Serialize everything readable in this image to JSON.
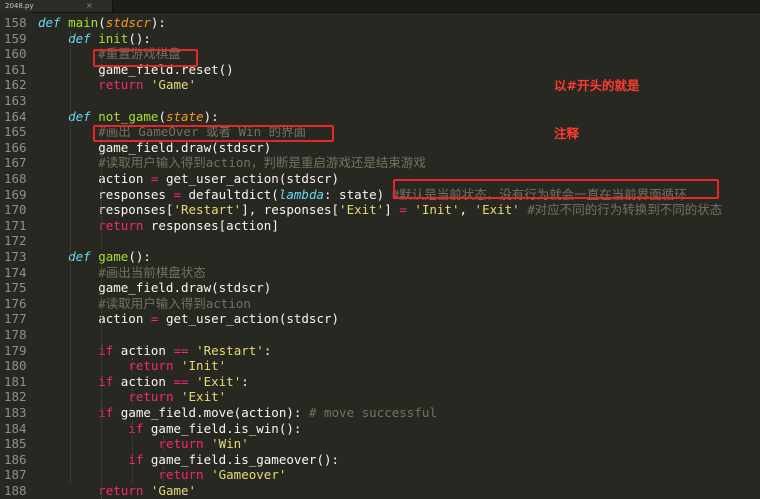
{
  "tab": {
    "filename": "2048.py",
    "close": "×"
  },
  "annotation": {
    "line1": "以#开头的就是",
    "line2": "注释"
  },
  "lines": [
    {
      "n": "158",
      "tokens": [
        [
          "kw",
          "def "
        ],
        [
          "fn",
          "main"
        ],
        [
          "",
          "("
        ],
        [
          "param",
          "stdscr"
        ],
        [
          "",
          "):"
        ]
      ]
    },
    {
      "n": "159",
      "tokens": [
        [
          "",
          "    "
        ],
        [
          "kw",
          "def "
        ],
        [
          "fn",
          "init"
        ],
        [
          "",
          "():"
        ]
      ]
    },
    {
      "n": "160",
      "tokens": [
        [
          "",
          "        "
        ],
        [
          "cm",
          "#重置游戏棋盘"
        ]
      ]
    },
    {
      "n": "161",
      "tokens": [
        [
          "",
          "        game_field.reset()"
        ]
      ]
    },
    {
      "n": "162",
      "tokens": [
        [
          "",
          "        "
        ],
        [
          "op",
          "return "
        ],
        [
          "str",
          "'Game'"
        ]
      ]
    },
    {
      "n": "163",
      "tokens": []
    },
    {
      "n": "164",
      "tokens": [
        [
          "",
          "    "
        ],
        [
          "kw",
          "def "
        ],
        [
          "fn",
          "not_game"
        ],
        [
          "",
          "("
        ],
        [
          "param",
          "state"
        ],
        [
          "",
          "):"
        ]
      ]
    },
    {
      "n": "165",
      "tokens": [
        [
          "",
          "        "
        ],
        [
          "cm",
          "#画出 GameOver 或者 Win 的界面"
        ]
      ]
    },
    {
      "n": "166",
      "tokens": [
        [
          "",
          "        game_field.draw(stdscr)"
        ]
      ]
    },
    {
      "n": "167",
      "tokens": [
        [
          "",
          "        "
        ],
        [
          "cm",
          "#读取用户输入得到action，判断是重启游戏还是结束游戏"
        ]
      ]
    },
    {
      "n": "168",
      "tokens": [
        [
          "",
          "        action "
        ],
        [
          "op",
          "="
        ],
        [
          "",
          " get_user_action(stdscr)"
        ]
      ]
    },
    {
      "n": "169",
      "tokens": [
        [
          "",
          "        responses "
        ],
        [
          "op",
          "="
        ],
        [
          "",
          " defaultdict("
        ],
        [
          "kw",
          "lambda"
        ],
        [
          "",
          ": state) "
        ],
        [
          "cm",
          "#默认是当前状态，没有行为就会一直在当前界面循环"
        ]
      ]
    },
    {
      "n": "170",
      "tokens": [
        [
          "",
          "        responses["
        ],
        [
          "str",
          "'Restart'"
        ],
        [
          "",
          "], responses["
        ],
        [
          "str",
          "'Exit'"
        ],
        [
          "",
          "] "
        ],
        [
          "op",
          "="
        ],
        [
          "",
          " "
        ],
        [
          "str",
          "'Init'"
        ],
        [
          "",
          ", "
        ],
        [
          "str",
          "'Exit'"
        ],
        [
          "",
          " "
        ],
        [
          "cm",
          "#对应不同的行为转换到不同的状态"
        ]
      ]
    },
    {
      "n": "171",
      "tokens": [
        [
          "",
          "        "
        ],
        [
          "op",
          "return "
        ],
        [
          "",
          "responses[action]"
        ]
      ]
    },
    {
      "n": "172",
      "tokens": []
    },
    {
      "n": "173",
      "tokens": [
        [
          "",
          "    "
        ],
        [
          "kw",
          "def "
        ],
        [
          "fn",
          "game"
        ],
        [
          "",
          "():"
        ]
      ]
    },
    {
      "n": "174",
      "tokens": [
        [
          "",
          "        "
        ],
        [
          "cm",
          "#画出当前棋盘状态"
        ]
      ]
    },
    {
      "n": "175",
      "tokens": [
        [
          "",
          "        game_field.draw(stdscr)"
        ]
      ]
    },
    {
      "n": "176",
      "tokens": [
        [
          "",
          "        "
        ],
        [
          "cm",
          "#读取用户输入得到action"
        ]
      ]
    },
    {
      "n": "177",
      "tokens": [
        [
          "",
          "        action "
        ],
        [
          "op",
          "="
        ],
        [
          "",
          " get_user_action(stdscr)"
        ]
      ]
    },
    {
      "n": "178",
      "tokens": []
    },
    {
      "n": "179",
      "tokens": [
        [
          "",
          "        "
        ],
        [
          "op",
          "if "
        ],
        [
          "",
          "action "
        ],
        [
          "op",
          "=="
        ],
        [
          "",
          " "
        ],
        [
          "str",
          "'Restart'"
        ],
        [
          "",
          ":"
        ]
      ]
    },
    {
      "n": "180",
      "tokens": [
        [
          "",
          "            "
        ],
        [
          "op",
          "return "
        ],
        [
          "str",
          "'Init'"
        ]
      ]
    },
    {
      "n": "181",
      "tokens": [
        [
          "",
          "        "
        ],
        [
          "op",
          "if "
        ],
        [
          "",
          "action "
        ],
        [
          "op",
          "=="
        ],
        [
          "",
          " "
        ],
        [
          "str",
          "'Exit'"
        ],
        [
          "",
          ":"
        ]
      ]
    },
    {
      "n": "182",
      "tokens": [
        [
          "",
          "            "
        ],
        [
          "op",
          "return "
        ],
        [
          "str",
          "'Exit'"
        ]
      ]
    },
    {
      "n": "183",
      "tokens": [
        [
          "",
          "        "
        ],
        [
          "op",
          "if "
        ],
        [
          "",
          "game_field.move(action): "
        ],
        [
          "cm",
          "# move successful"
        ]
      ]
    },
    {
      "n": "184",
      "tokens": [
        [
          "",
          "            "
        ],
        [
          "op",
          "if "
        ],
        [
          "",
          "game_field.is_win():"
        ]
      ]
    },
    {
      "n": "185",
      "tokens": [
        [
          "",
          "                "
        ],
        [
          "op",
          "return "
        ],
        [
          "str",
          "'Win'"
        ]
      ]
    },
    {
      "n": "186",
      "tokens": [
        [
          "",
          "            "
        ],
        [
          "op",
          "if "
        ],
        [
          "",
          "game_field.is_gameover():"
        ]
      ]
    },
    {
      "n": "187",
      "tokens": [
        [
          "",
          "                "
        ],
        [
          "op",
          "return "
        ],
        [
          "str",
          "'Gameover'"
        ]
      ]
    },
    {
      "n": "188",
      "tokens": [
        [
          "",
          "        "
        ],
        [
          "op",
          "return "
        ],
        [
          "str",
          "'Game'"
        ]
      ]
    }
  ]
}
